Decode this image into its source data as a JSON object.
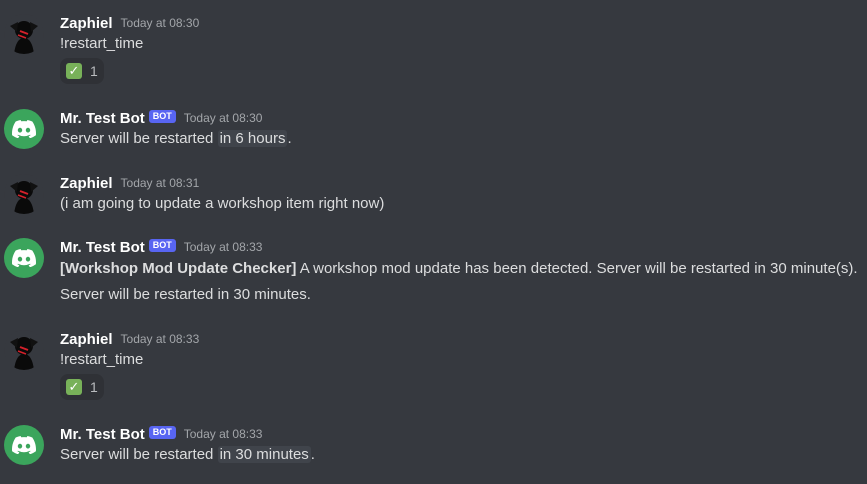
{
  "messages": [
    {
      "author": "Zaphiel",
      "timestamp": "Today at 08:30",
      "text": "!restart_time",
      "reaction": {
        "emoji": "✓",
        "count": "1"
      }
    },
    {
      "author": "Mr. Test Bot",
      "bot_tag": "BOT",
      "timestamp": "Today at 08:30",
      "text_before": "Server will be restarted",
      "time_highlight": "in 6 hours",
      "text_after": "."
    },
    {
      "author": "Zaphiel",
      "timestamp": "Today at 08:31",
      "text": "(i am going to update a workshop item right now)"
    },
    {
      "author": "Mr. Test Bot",
      "bot_tag": "BOT",
      "timestamp": "Today at 08:33",
      "bold_prefix": "[Workshop Mod Update Checker]",
      "text": "A workshop mod update has been detected. Server will be restarted in 30 minute(s).",
      "text2": "Server will be restarted in 30 minutes."
    },
    {
      "author": "Zaphiel",
      "timestamp": "Today at 08:33",
      "text": "!restart_time",
      "reaction": {
        "emoji": "✓",
        "count": "1"
      }
    },
    {
      "author": "Mr. Test Bot",
      "bot_tag": "BOT",
      "timestamp": "Today at 08:33",
      "text_before": "Server will be restarted",
      "time_highlight": "in 30 minutes",
      "text_after": "."
    }
  ],
  "colors": {
    "background": "#36393f",
    "bot_tag": "#5865f2",
    "bot_avatar": "#3ba55c",
    "reaction_check": "#78b159"
  },
  "icons": {
    "user_avatar": "zaphiel-avatar-icon",
    "bot_avatar": "discord-logo-icon",
    "reaction": "check-mark-icon"
  }
}
